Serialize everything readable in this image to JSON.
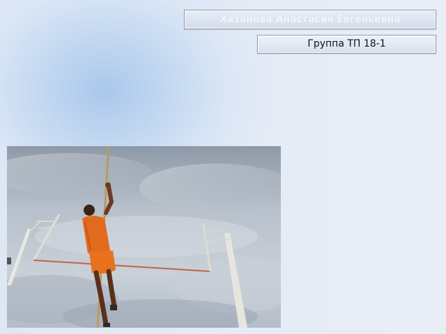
{
  "slide": {
    "author_name": "Хазанова Анастасия Евгеньевна",
    "group_label": "Группа ТП 18-1"
  },
  "photo": {
    "subject": "pole-vaulter-photo",
    "colors": {
      "sky": "#b9c2cd",
      "uniform": "#e26a1c",
      "crossbar": "#c0624f",
      "pole": "#b99a5c"
    }
  }
}
